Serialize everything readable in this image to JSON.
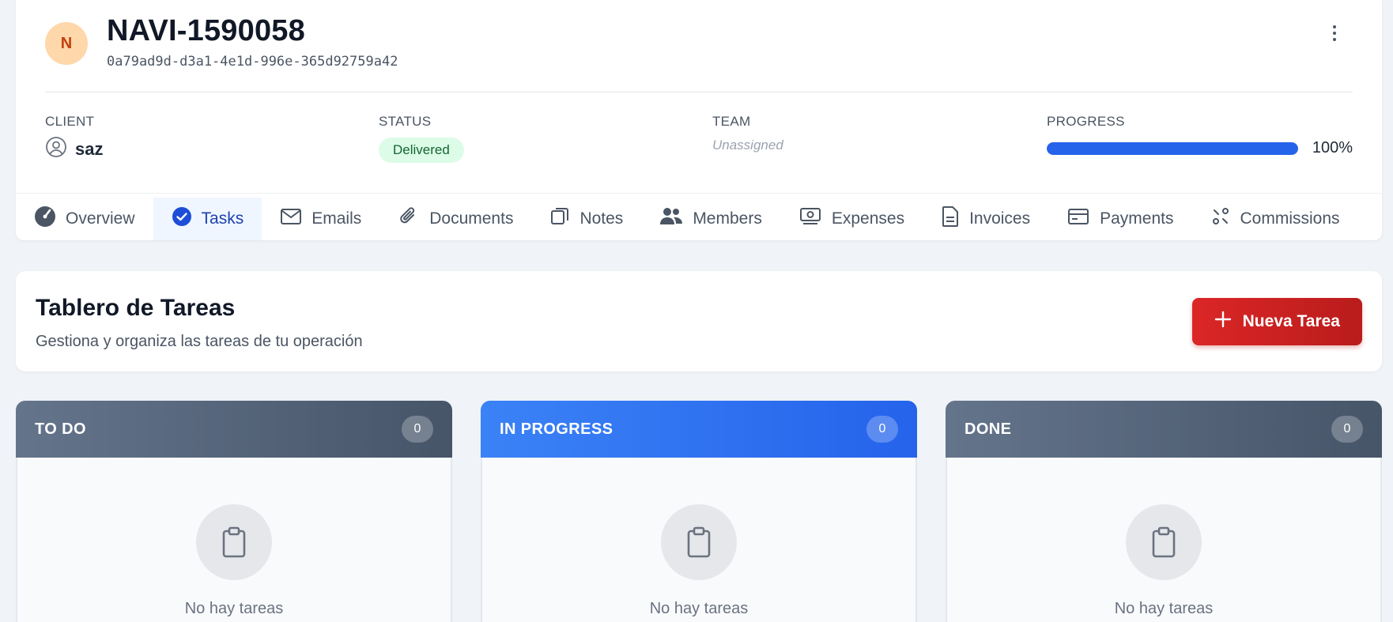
{
  "header": {
    "avatar_initial": "N",
    "title": "NAVI-1590058",
    "uuid": "0a79ad9d-d3a1-4e1d-996e-365d92759a42",
    "menu_icon": "more-vertical-icon"
  },
  "meta": {
    "client": {
      "label": "CLIENT",
      "value": "saz",
      "icon": "user-circle-icon"
    },
    "status": {
      "label": "STATUS",
      "value": "Delivered",
      "color": "#dcfce7"
    },
    "team": {
      "label": "TEAM",
      "value": "Unassigned"
    },
    "progress": {
      "label": "PROGRESS",
      "value": 1.0,
      "text": "100%",
      "color": "#2563eb"
    }
  },
  "tabs": [
    {
      "label": "Overview",
      "icon": "gauge-icon"
    },
    {
      "label": "Tasks",
      "icon": "check-circle-icon",
      "active": true
    },
    {
      "label": "Emails",
      "icon": "mail-icon"
    },
    {
      "label": "Documents",
      "icon": "paperclip-icon"
    },
    {
      "label": "Notes",
      "icon": "note-icon"
    },
    {
      "label": "Members",
      "icon": "users-icon"
    },
    {
      "label": "Expenses",
      "icon": "banknote-icon"
    },
    {
      "label": "Invoices",
      "icon": "file-text-icon"
    },
    {
      "label": "Payments",
      "icon": "credit-card-icon"
    },
    {
      "label": "Commissions",
      "icon": "commission-icon"
    }
  ],
  "board": {
    "title": "Tablero de Tareas",
    "subtitle": "Gestiona y organiza las tareas de tu operación",
    "new_task_label": "Nueva Tarea",
    "accent": "#dc2626"
  },
  "columns": [
    {
      "title": "TO DO",
      "count": "0",
      "empty_text": "No hay tareas",
      "color": "#64748b"
    },
    {
      "title": "IN PROGRESS",
      "count": "0",
      "empty_text": "No hay tareas",
      "color": "#3b82f6"
    },
    {
      "title": "DONE",
      "count": "0",
      "empty_text": "No hay tareas",
      "color": "#64748b"
    }
  ]
}
